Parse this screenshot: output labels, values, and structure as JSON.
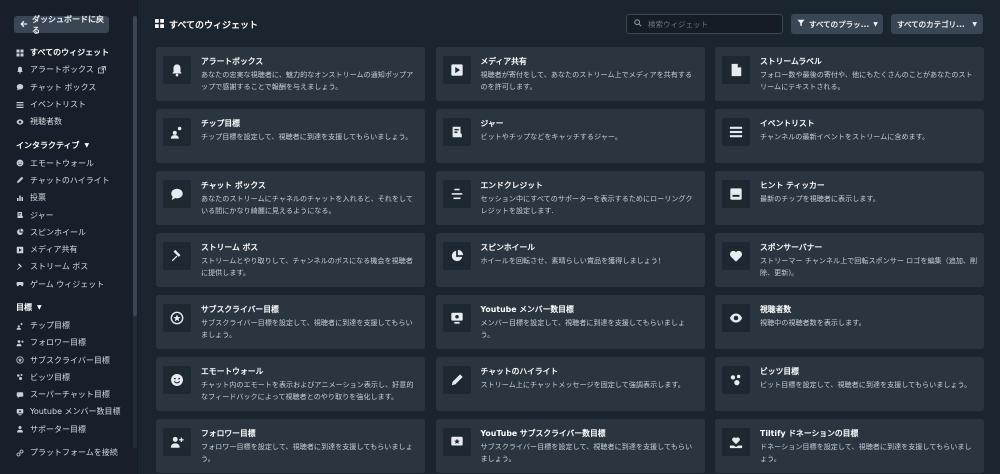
{
  "sidebar": {
    "back_label": "ダッシュボードに戻る",
    "top_items": [
      {
        "label": "すべてのウィジェット",
        "icon": "grid-icon",
        "active": true
      },
      {
        "label": "アラートボックス",
        "icon": "bell-icon",
        "external": true
      },
      {
        "label": "チャット ボックス",
        "icon": "chat-icon"
      },
      {
        "label": "イベントリスト",
        "icon": "list-icon"
      },
      {
        "label": "視聴者数",
        "icon": "eye-icon"
      }
    ],
    "interactive_head": "インタラクティブ",
    "interactive_items": [
      {
        "label": "エモートウォール",
        "icon": "smile-icon"
      },
      {
        "label": "チャットのハイライト",
        "icon": "pen-icon"
      },
      {
        "label": "投票",
        "icon": "poll-icon"
      },
      {
        "label": "ジャー",
        "icon": "jar-icon"
      },
      {
        "label": "スピンホイール",
        "icon": "pie-icon"
      },
      {
        "label": "メディア共有",
        "icon": "play-icon"
      },
      {
        "label": "ストリーム ボス",
        "icon": "hammer-icon"
      },
      {
        "label": "ゲーム ウィジェット",
        "icon": "gamepad-icon"
      }
    ],
    "goals_head": "目標",
    "goal_items": [
      {
        "label": "チップ目標",
        "icon": "tip-icon"
      },
      {
        "label": "フォロワー目標",
        "icon": "user-plus-icon"
      },
      {
        "label": "サブスクライバー目標",
        "icon": "star-badge-icon"
      },
      {
        "label": "ビッツ目標",
        "icon": "bits-icon"
      },
      {
        "label": "スーパーチャット目標",
        "icon": "superchat-icon"
      },
      {
        "label": "Youtube メンバー数目標",
        "icon": "member-icon"
      },
      {
        "label": "サポーター目標",
        "icon": "supporter-icon"
      }
    ],
    "connect_label": "プラットフォームを接続"
  },
  "header": {
    "title": "すべてのウィジェット",
    "search_placeholder": "検索ウィジェット",
    "platform_filter": "すべてのプラッ...",
    "category_filter": "すべてのカテゴリ..."
  },
  "widgets": [
    {
      "name": "アラートボックス",
      "desc": "あなたの忠実な視聴者に、魅力的なオンストリームの通知ポップアップで感謝することで報酬を与えましょう。",
      "icon": "bell-icon"
    },
    {
      "name": "メディア共有",
      "desc": "視聴者が寄付をして、あなたのストリーム上でメディアを共有するのを許可します。",
      "icon": "play-icon"
    },
    {
      "name": "ストリームラベル",
      "desc": "フォロー数や最後の寄付や、他にもたくさんのことがあなたのストリームにテキストされる。",
      "icon": "file-icon"
    },
    {
      "name": "チップ目標",
      "desc": "チップ目標を設定して、視聴者に到達を支援してもらいましょう。",
      "icon": "tip-icon"
    },
    {
      "name": "ジャー",
      "desc": "ビットやチップなどをキャッチするジャー。",
      "icon": "jar-icon"
    },
    {
      "name": "イベントリスト",
      "desc": "チャンネルの最新イベントをストリームに含めます。",
      "icon": "list-icon"
    },
    {
      "name": "チャット ボックス",
      "desc": "あなたのストリームにチャネルのチャットを入れると、それをしている間にかなり綺麗に見えるようになる。",
      "icon": "chat-icon"
    },
    {
      "name": "エンドクレジット",
      "desc": "セッション中にすべてのサポーターを表示するためにローリングクレジットを設定します.",
      "icon": "credits-icon"
    },
    {
      "name": "ヒント ティッカー",
      "desc": "最新のチップを視聴者に表示します。",
      "icon": "ticker-icon"
    },
    {
      "name": "ストリーム ボス",
      "desc": "ストリームとやり取りして、チャンネルのボスになる機会を視聴者に提供します。",
      "icon": "hammer-icon"
    },
    {
      "name": "スピンホイール",
      "desc": "ホイールを回転させ、素晴らしい賞品を獲得しましょう！",
      "icon": "pie-icon"
    },
    {
      "name": "スポンサーバナー",
      "desc": "ストリーマー チャンネル上で回転スポンサー ロゴを編集（追加、削除、更新)。",
      "icon": "heart-icon"
    },
    {
      "name": "サブスクライバー目標",
      "desc": "サブスクライバー目標を設定して、視聴者に到達を支援してもらいましょう。",
      "icon": "star-badge-icon"
    },
    {
      "name": "Youtube メンバー数目標",
      "desc": "メンバー目標を設定して、視聴者に到達を支援してもらいましょう。",
      "icon": "member-icon"
    },
    {
      "name": "視聴者数",
      "desc": "視聴中の視聴者数を表示します。",
      "icon": "eye-icon"
    },
    {
      "name": "エモートウォール",
      "desc": "チャット内のエモートを表示およびアニメーション表示し、好意的なフィードバックによって視聴者とのやり取りを強化します。",
      "icon": "smile-icon"
    },
    {
      "name": "チャットのハイライト",
      "desc": "ストリーム上にチャットメッセージを固定して強調表示します。",
      "icon": "pen-icon"
    },
    {
      "name": "ビッツ目標",
      "desc": "ビット目標を設定して、視聴者に到達を支援してもらいましょう。",
      "icon": "bits-icon"
    },
    {
      "name": "フォロワー目標",
      "desc": "フォロワー目標を設定して、視聴者に到達を支援してもらいましょう。",
      "icon": "user-plus-icon"
    },
    {
      "name": "YouTube サブスクライバー数目標",
      "desc": "サブスクライバー目標を設定して、視聴者に到達を支援してもらいましょう。",
      "icon": "yt-sub-icon"
    },
    {
      "name": "Tiltify ドネーションの目標",
      "desc": "ドネーション目標を設定して、視聴者に到達を支援してもらいましょう。",
      "icon": "donation-icon"
    }
  ]
}
